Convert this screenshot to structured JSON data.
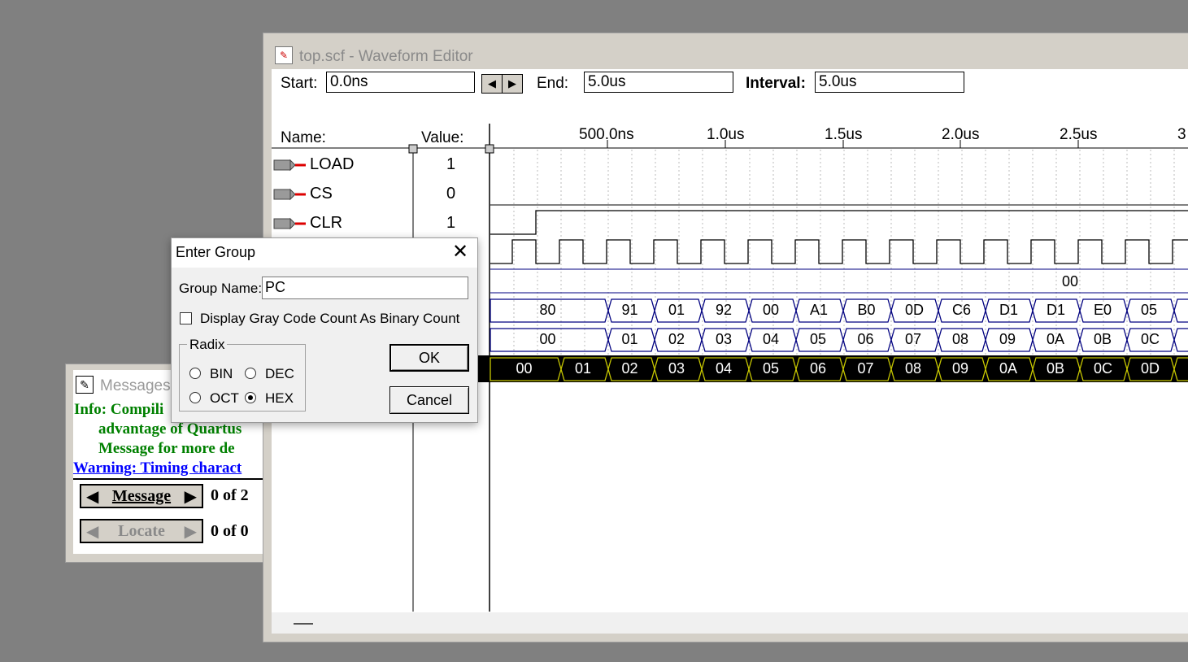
{
  "messages_window": {
    "title": "Messages",
    "lines": [
      {
        "text": "Info: Compili",
        "color": "#008000"
      },
      {
        "text": "advantage of Quartus",
        "color": "#008000"
      },
      {
        "text": "Message for more de",
        "color": "#008000"
      },
      {
        "text": "Warning: Timing charact",
        "color": "#0000ff"
      }
    ],
    "message_button": "Message",
    "message_count": "0 of 2",
    "locate_button": "Locate",
    "locate_count": "0 of 0"
  },
  "waveform_editor": {
    "title": "top.scf - Waveform Editor",
    "start_label": "Start:",
    "start_value": "0.0ns",
    "end_label": "End:",
    "end_value": "5.0us",
    "interval_label": "Interval:",
    "interval_value": "5.0us",
    "name_header": "Name:",
    "value_header": "Value:",
    "ruler_ticks": [
      "500.0ns",
      "1.0us",
      "1.5us",
      "2.0us",
      "2.5us",
      "3"
    ],
    "signals": [
      {
        "name": "LOAD",
        "value": "1"
      },
      {
        "name": "CS",
        "value": "0"
      },
      {
        "name": "CLR",
        "value": "1"
      }
    ],
    "bus_row1_label": "00",
    "bus_row2": [
      "80",
      "91",
      "01",
      "92",
      "00",
      "A1",
      "B0",
      "0D",
      "C6",
      "D1",
      "D1",
      "E0",
      "05"
    ],
    "bus_row3": [
      "00",
      "01",
      "02",
      "03",
      "04",
      "05",
      "06",
      "07",
      "08",
      "09",
      "0A",
      "0B",
      "0C"
    ],
    "bus_row4": [
      "00",
      "01",
      "02",
      "03",
      "04",
      "05",
      "06",
      "07",
      "08",
      "09",
      "0A",
      "0B",
      "0C",
      "0D"
    ]
  },
  "dialog": {
    "title": "Enter Group",
    "group_name_label": "Group Name:",
    "group_name_value": "PC",
    "gray_code_label": "Display Gray Code Count As Binary Count",
    "gray_code_checked": false,
    "radix_label": "Radix",
    "radix_options": [
      "BIN",
      "DEC",
      "OCT",
      "HEX"
    ],
    "radix_selected": "HEX",
    "ok_button": "OK",
    "cancel_button": "Cancel"
  }
}
